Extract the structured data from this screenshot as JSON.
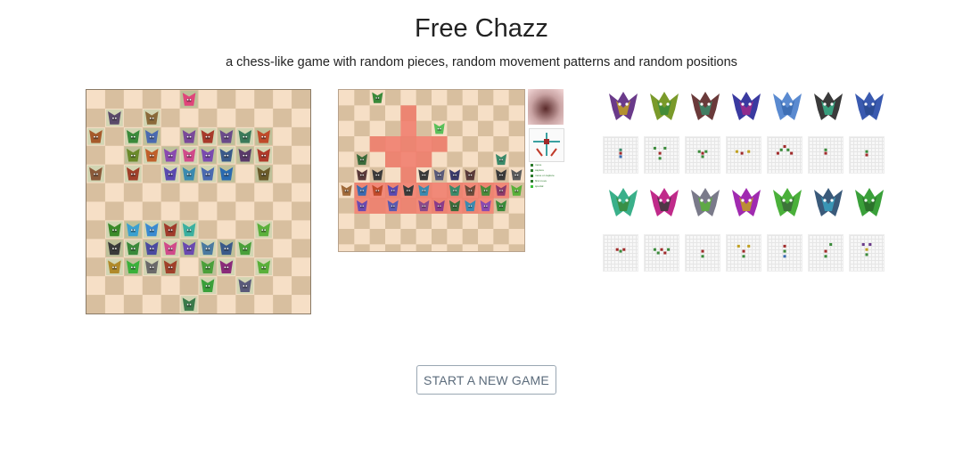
{
  "header": {
    "title": "Free Chazz",
    "subtitle": "a chess-like game with random pieces, random movement patterns and random positions"
  },
  "colors": {
    "light_square": "#f6dfc6",
    "dark_square": "#d8bf9f",
    "highlight": "#f07a6a",
    "button_text": "#5b6b7b"
  },
  "main_board": {
    "files": 10,
    "ranks": 10,
    "pieces": [
      {
        "c": 5,
        "r": 0,
        "col": "#e0457a"
      },
      {
        "c": 1,
        "r": 1,
        "col": "#5a4a6a"
      },
      {
        "c": 3,
        "r": 1,
        "col": "#8a6a3a"
      },
      {
        "c": 0,
        "r": 2,
        "col": "#a65a2a"
      },
      {
        "c": 2,
        "r": 2,
        "col": "#3a8a3a"
      },
      {
        "c": 3,
        "r": 2,
        "col": "#4a6ab0"
      },
      {
        "c": 5,
        "r": 2,
        "col": "#7a4a9a"
      },
      {
        "c": 6,
        "r": 2,
        "col": "#a83a2a"
      },
      {
        "c": 7,
        "r": 2,
        "col": "#6a4a8a"
      },
      {
        "c": 8,
        "r": 2,
        "col": "#3a7a5a"
      },
      {
        "c": 9,
        "r": 2,
        "col": "#c04a2a"
      },
      {
        "c": 2,
        "r": 3,
        "col": "#6a8a2a"
      },
      {
        "c": 3,
        "r": 3,
        "col": "#c0602a"
      },
      {
        "c": 4,
        "r": 3,
        "col": "#8a4ab0"
      },
      {
        "c": 5,
        "r": 3,
        "col": "#d04a8a"
      },
      {
        "c": 6,
        "r": 3,
        "col": "#7a4ab0"
      },
      {
        "c": 7,
        "r": 3,
        "col": "#3a5a8a"
      },
      {
        "c": 8,
        "r": 3,
        "col": "#5a3a6a"
      },
      {
        "c": 9,
        "r": 3,
        "col": "#b03a2a"
      },
      {
        "c": 0,
        "r": 4,
        "col": "#8a5a3a"
      },
      {
        "c": 2,
        "r": 4,
        "col": "#a0402a"
      },
      {
        "c": 4,
        "r": 4,
        "col": "#5a4ab0"
      },
      {
        "c": 5,
        "r": 4,
        "col": "#3a8ab0"
      },
      {
        "c": 6,
        "r": 4,
        "col": "#4a6ab0"
      },
      {
        "c": 7,
        "r": 4,
        "col": "#2a6ab0"
      },
      {
        "c": 9,
        "r": 4,
        "col": "#6a5a2a"
      },
      {
        "c": 1,
        "r": 7,
        "col": "#3a8a2a"
      },
      {
        "c": 2,
        "r": 7,
        "col": "#3aa0d0"
      },
      {
        "c": 3,
        "r": 7,
        "col": "#3a8ad0"
      },
      {
        "c": 4,
        "r": 7,
        "col": "#a03a2a"
      },
      {
        "c": 5,
        "r": 7,
        "col": "#3ab0a0"
      },
      {
        "c": 9,
        "r": 7,
        "col": "#5ab03a"
      },
      {
        "c": 1,
        "r": 8,
        "col": "#3a3a3a"
      },
      {
        "c": 2,
        "r": 8,
        "col": "#3a8a3a"
      },
      {
        "c": 3,
        "r": 8,
        "col": "#4a4aa0"
      },
      {
        "c": 4,
        "r": 8,
        "col": "#d04a8a"
      },
      {
        "c": 5,
        "r": 8,
        "col": "#6a4ab0"
      },
      {
        "c": 6,
        "r": 8,
        "col": "#4a7aa0"
      },
      {
        "c": 7,
        "r": 8,
        "col": "#3a5a8a"
      },
      {
        "c": 8,
        "r": 8,
        "col": "#4aa03a"
      },
      {
        "c": 1,
        "r": 9,
        "col": "#b08a2a"
      },
      {
        "c": 2,
        "r": 9,
        "col": "#3ab03a"
      },
      {
        "c": 3,
        "r": 9,
        "col": "#6a6a6a"
      },
      {
        "c": 4,
        "r": 9,
        "col": "#a0402a"
      },
      {
        "c": 6,
        "r": 9,
        "col": "#4aa03a"
      },
      {
        "c": 7,
        "r": 9,
        "col": "#8a2a7a"
      },
      {
        "c": 9,
        "r": 9,
        "col": "#5ab03a"
      },
      {
        "c": 6,
        "r": 10,
        "col": "#3aa03a"
      },
      {
        "c": 8,
        "r": 10,
        "col": "#5a5a7a"
      },
      {
        "c": 5,
        "r": 11,
        "col": "#3a7a4a"
      }
    ]
  },
  "preview_board": {
    "files": 12,
    "ranks": 10,
    "highlight_cells": [
      [
        4,
        1
      ],
      [
        4,
        2
      ],
      [
        2,
        3
      ],
      [
        3,
        3
      ],
      [
        4,
        3
      ],
      [
        5,
        3
      ],
      [
        6,
        3
      ],
      [
        3,
        4
      ],
      [
        4,
        4
      ],
      [
        5,
        4
      ],
      [
        4,
        5
      ],
      [
        1,
        6
      ],
      [
        2,
        6
      ],
      [
        3,
        6
      ],
      [
        4,
        6
      ],
      [
        5,
        6
      ],
      [
        6,
        6
      ],
      [
        7,
        6
      ],
      [
        8,
        6
      ],
      [
        9,
        6
      ],
      [
        10,
        6
      ],
      [
        1,
        7
      ],
      [
        2,
        7
      ],
      [
        3,
        7
      ],
      [
        4,
        7
      ],
      [
        5,
        7
      ],
      [
        6,
        7
      ],
      [
        7,
        7
      ],
      [
        8,
        7
      ],
      [
        9,
        7
      ]
    ],
    "pieces": [
      {
        "c": 2,
        "r": 0,
        "col": "#3a8a3a"
      },
      {
        "c": 6,
        "r": 2,
        "col": "#5ac05a"
      },
      {
        "c": 1,
        "r": 4,
        "col": "#3a6a3a"
      },
      {
        "c": 10,
        "r": 4,
        "col": "#3a8a6a"
      },
      {
        "c": 1,
        "r": 5,
        "col": "#5a3a3a"
      },
      {
        "c": 2,
        "r": 5,
        "col": "#3a3a3a"
      },
      {
        "c": 5,
        "r": 5,
        "col": "#3a3a3a"
      },
      {
        "c": 6,
        "r": 5,
        "col": "#5a5a7a"
      },
      {
        "c": 7,
        "r": 5,
        "col": "#3a3a6a"
      },
      {
        "c": 8,
        "r": 5,
        "col": "#5a3a3a"
      },
      {
        "c": 10,
        "r": 5,
        "col": "#3a3a3a"
      },
      {
        "c": 11,
        "r": 5,
        "col": "#5a5a5a"
      },
      {
        "c": 0,
        "r": 6,
        "col": "#a06a3a"
      },
      {
        "c": 1,
        "r": 6,
        "col": "#3a6ab0"
      },
      {
        "c": 2,
        "r": 6,
        "col": "#c04a2a"
      },
      {
        "c": 3,
        "r": 6,
        "col": "#5a4ab0"
      },
      {
        "c": 4,
        "r": 6,
        "col": "#3a3a3a"
      },
      {
        "c": 5,
        "r": 6,
        "col": "#3a8ab0"
      },
      {
        "c": 7,
        "r": 6,
        "col": "#3a8a6a"
      },
      {
        "c": 8,
        "r": 6,
        "col": "#6a4a3a"
      },
      {
        "c": 9,
        "r": 6,
        "col": "#4a8a3a"
      },
      {
        "c": 10,
        "r": 6,
        "col": "#8a3a6a"
      },
      {
        "c": 11,
        "r": 6,
        "col": "#5ab03a"
      },
      {
        "c": 1,
        "r": 7,
        "col": "#6a4ab0"
      },
      {
        "c": 3,
        "r": 7,
        "col": "#5a5ab0"
      },
      {
        "c": 5,
        "r": 7,
        "col": "#8a4a8a"
      },
      {
        "c": 6,
        "r": 7,
        "col": "#8a3a8a"
      },
      {
        "c": 7,
        "r": 7,
        "col": "#3a6a3a"
      },
      {
        "c": 8,
        "r": 7,
        "col": "#3a8ab0"
      },
      {
        "c": 9,
        "r": 7,
        "col": "#8a4ab0"
      },
      {
        "c": 10,
        "r": 7,
        "col": "#3a8a3a"
      }
    ]
  },
  "detail_panel": {
    "legend": [
      {
        "text": "move",
        "color": "#2a7a2a"
      },
      {
        "text": "capture",
        "color": "#2a7a2a"
      },
      {
        "text": "move or capture",
        "color": "#2a7a2a"
      },
      {
        "text": "first move",
        "color": "#2a7a2a"
      },
      {
        "text": "special",
        "color": "#3ac03a"
      }
    ]
  },
  "gallery": {
    "piece_row_1": [
      {
        "name": "piece-1",
        "body": "#6a3a8a",
        "accent": "#c0a020"
      },
      {
        "name": "piece-2",
        "body": "#7a9a2a",
        "accent": "#3a8a3a"
      },
      {
        "name": "piece-3",
        "body": "#6a3a3a",
        "accent": "#3a8a6a"
      },
      {
        "name": "piece-4",
        "body": "#3a3aa0",
        "accent": "#a02a8a"
      },
      {
        "name": "piece-5",
        "body": "#5a8ad0",
        "accent": "#3a6ab0"
      },
      {
        "name": "piece-6",
        "body": "#3a3a3a",
        "accent": "#3ab08a"
      },
      {
        "name": "piece-7",
        "body": "#3a5ab0",
        "accent": "#2a4a90"
      }
    ],
    "pattern_row_1": [
      {
        "dots": [
          [
            10,
            7,
            "#3a8a6a"
          ],
          [
            10,
            9,
            "#a02a2a"
          ],
          [
            10,
            11,
            "#3a6ab0"
          ]
        ]
      },
      {
        "dots": [
          [
            6,
            6,
            "#3a8a3a"
          ],
          [
            12,
            6,
            "#3a8a3a"
          ],
          [
            9,
            9,
            "#a02a2a"
          ],
          [
            9,
            12,
            "#3a8a3a"
          ]
        ]
      },
      {
        "dots": [
          [
            10,
            9,
            "#a02a2a"
          ],
          [
            8,
            8,
            "#3a8a3a"
          ],
          [
            12,
            8,
            "#3a8a3a"
          ],
          [
            10,
            11,
            "#3a8a3a"
          ]
        ]
      },
      {
        "dots": [
          [
            6,
            8,
            "#c0a020"
          ],
          [
            13,
            8,
            "#c0a020"
          ],
          [
            9,
            9,
            "#a02a2a"
          ]
        ]
      },
      {
        "dots": [
          [
            10,
            5,
            "#a02a2a"
          ],
          [
            8,
            7,
            "#3a8a3a"
          ],
          [
            12,
            7,
            "#3a8a3a"
          ],
          [
            6,
            9,
            "#a02a2a"
          ],
          [
            14,
            9,
            "#a02a2a"
          ]
        ]
      },
      {
        "dots": [
          [
            10,
            7,
            "#3a8a3a"
          ],
          [
            10,
            9,
            "#a02a2a"
          ]
        ]
      },
      {
        "dots": [
          [
            10,
            8,
            "#3a8a3a"
          ],
          [
            10,
            10,
            "#a02a2a"
          ]
        ]
      }
    ],
    "piece_row_2": [
      {
        "name": "piece-8",
        "body": "#3ab08a",
        "accent": "#3a8a3a"
      },
      {
        "name": "piece-9",
        "body": "#c02a8a",
        "accent": "#3a3a3a"
      },
      {
        "name": "piece-10",
        "body": "#7a7a8a",
        "accent": "#5ab03a"
      },
      {
        "name": "piece-11",
        "body": "#a02ab0",
        "accent": "#c0a020"
      },
      {
        "name": "piece-12",
        "body": "#4ab03a",
        "accent": "#3a6a3a"
      },
      {
        "name": "piece-13",
        "body": "#3a5a7a",
        "accent": "#3aa0c0"
      },
      {
        "name": "piece-14",
        "body": "#3aa03a",
        "accent": "#2a6a2a"
      }
    ],
    "pattern_row_2": [
      {
        "dots": [
          [
            8,
            8,
            "#a02a2a"
          ],
          [
            12,
            8,
            "#a02a2a"
          ],
          [
            10,
            9,
            "#3a8a3a"
          ]
        ]
      },
      {
        "dots": [
          [
            6,
            8,
            "#3a8a3a"
          ],
          [
            10,
            8,
            "#a02a2a"
          ],
          [
            14,
            8,
            "#3a8a3a"
          ],
          [
            8,
            10,
            "#3a8a3a"
          ],
          [
            12,
            10,
            "#a02a2a"
          ]
        ]
      },
      {
        "dots": [
          [
            10,
            9,
            "#a02a2a"
          ],
          [
            10,
            12,
            "#3a8a3a"
          ]
        ]
      },
      {
        "dots": [
          [
            7,
            6,
            "#c0a020"
          ],
          [
            13,
            6,
            "#c0a020"
          ],
          [
            10,
            9,
            "#a02a2a"
          ],
          [
            10,
            12,
            "#3a8a3a"
          ]
        ]
      },
      {
        "dots": [
          [
            10,
            6,
            "#a02a2a"
          ],
          [
            10,
            9,
            "#3a8a3a"
          ],
          [
            10,
            12,
            "#3a6ab0"
          ]
        ]
      },
      {
        "dots": [
          [
            13,
            5,
            "#3a8a3a"
          ],
          [
            10,
            9,
            "#a02a2a"
          ],
          [
            10,
            12,
            "#3a8a3a"
          ]
        ]
      },
      {
        "dots": [
          [
            8,
            5,
            "#6a3a8a"
          ],
          [
            12,
            5,
            "#6a3a8a"
          ],
          [
            10,
            8,
            "#c0a020"
          ],
          [
            10,
            11,
            "#3a8a3a"
          ]
        ]
      }
    ]
  },
  "actions": {
    "start_label": "START A NEW GAME"
  }
}
